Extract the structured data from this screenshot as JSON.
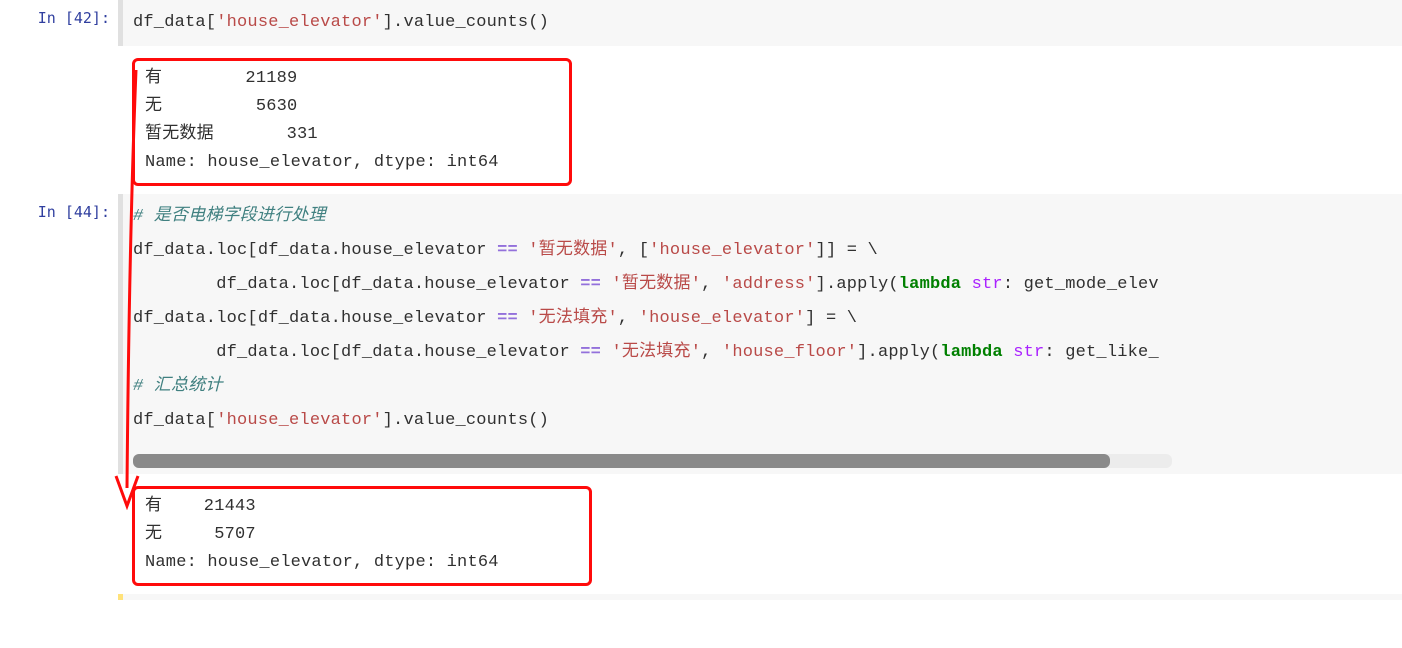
{
  "cell1": {
    "prompt": "In [42]:",
    "code_tokens": [
      {
        "t": "df_data[",
        "c": "txt"
      },
      {
        "t": "'house_elevator'",
        "c": "str"
      },
      {
        "t": "].value_counts()",
        "c": "txt"
      }
    ],
    "output": "有        21189\n无         5630\n暂无数据       331\nName: house_elevator, dtype: int64"
  },
  "cell2": {
    "prompt": "In [44]:",
    "code_lines": [
      [
        {
          "t": "# 是否电梯字段进行处理",
          "c": "cm"
        }
      ],
      [
        {
          "t": "df_data.loc[df_data.house_elevator ",
          "c": "txt"
        },
        {
          "t": "==",
          "c": "op"
        },
        {
          "t": " ",
          "c": "txt"
        },
        {
          "t": "'暂无数据'",
          "c": "str"
        },
        {
          "t": ", [",
          "c": "txt"
        },
        {
          "t": "'house_elevator'",
          "c": "str"
        },
        {
          "t": "]] = \\",
          "c": "txt"
        }
      ],
      [
        {
          "t": "        df_data.loc[df_data.house_elevator ",
          "c": "txt"
        },
        {
          "t": "==",
          "c": "op"
        },
        {
          "t": " ",
          "c": "txt"
        },
        {
          "t": "'暂无数据'",
          "c": "str"
        },
        {
          "t": ", ",
          "c": "txt"
        },
        {
          "t": "'address'",
          "c": "str"
        },
        {
          "t": "].apply(",
          "c": "txt"
        },
        {
          "t": "lambda",
          "c": "kw"
        },
        {
          "t": " ",
          "c": "txt"
        },
        {
          "t": "str",
          "c": "argn"
        },
        {
          "t": ": get_mode_elev",
          "c": "txt"
        }
      ],
      [
        {
          "t": "df_data.loc[df_data.house_elevator ",
          "c": "txt"
        },
        {
          "t": "==",
          "c": "op"
        },
        {
          "t": " ",
          "c": "txt"
        },
        {
          "t": "'无法填充'",
          "c": "str"
        },
        {
          "t": ", ",
          "c": "txt"
        },
        {
          "t": "'house_elevator'",
          "c": "str"
        },
        {
          "t": "] = \\",
          "c": "txt"
        }
      ],
      [
        {
          "t": "        df_data.loc[df_data.house_elevator ",
          "c": "txt"
        },
        {
          "t": "==",
          "c": "op"
        },
        {
          "t": " ",
          "c": "txt"
        },
        {
          "t": "'无法填充'",
          "c": "str"
        },
        {
          "t": ", ",
          "c": "txt"
        },
        {
          "t": "'house_floor'",
          "c": "str"
        },
        {
          "t": "].apply(",
          "c": "txt"
        },
        {
          "t": "lambda",
          "c": "kw"
        },
        {
          "t": " ",
          "c": "txt"
        },
        {
          "t": "str",
          "c": "argn"
        },
        {
          "t": ": get_like_",
          "c": "txt"
        }
      ],
      [
        {
          "t": "# 汇总统计",
          "c": "cm"
        }
      ],
      [
        {
          "t": "df_data[",
          "c": "txt"
        },
        {
          "t": "'house_elevator'",
          "c": "str"
        },
        {
          "t": "].value_counts()",
          "c": "txt"
        }
      ]
    ],
    "output": "有    21443\n无     5707\nName: house_elevator, dtype: int64"
  }
}
